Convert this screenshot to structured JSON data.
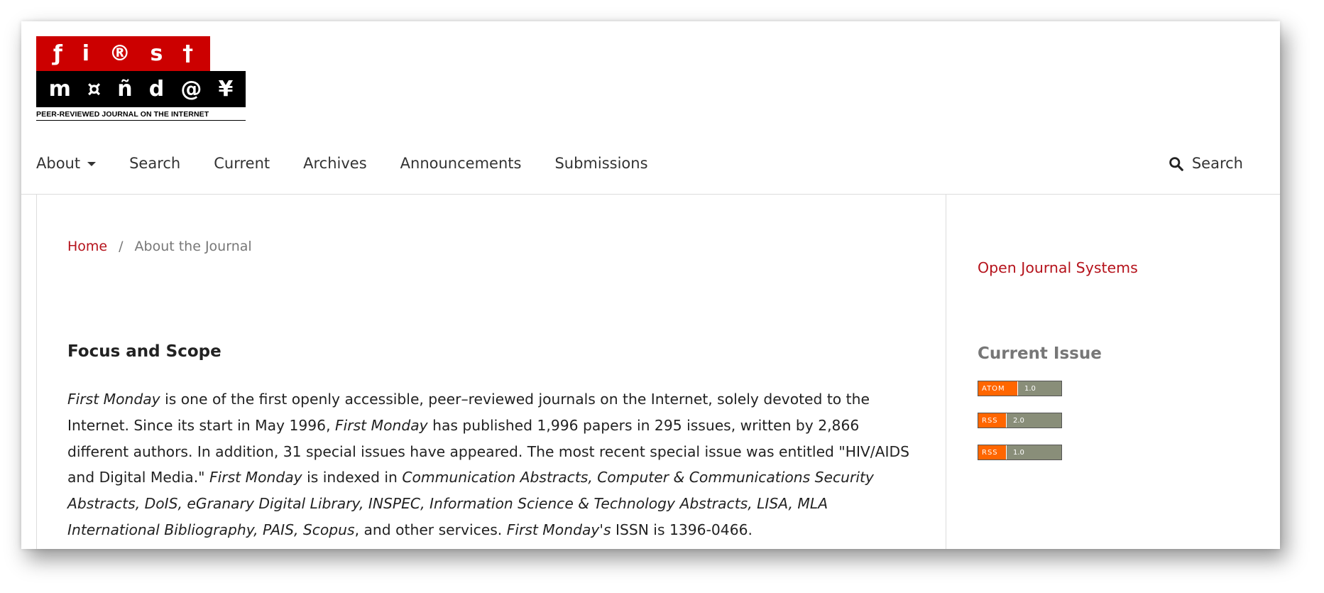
{
  "logo": {
    "row1": [
      "ƒ",
      "i",
      "®",
      "s",
      "†"
    ],
    "row2": [
      "m",
      "¤",
      "ñ",
      "d",
      "@",
      "¥"
    ],
    "tagline": "PEER-REVIEWED JOURNAL ON THE INTERNET",
    "colors": {
      "red": "#cc0000",
      "black": "#000000"
    }
  },
  "nav": {
    "items": [
      {
        "label": "About",
        "has_dropdown": true
      },
      {
        "label": "Search"
      },
      {
        "label": "Current"
      },
      {
        "label": "Archives"
      },
      {
        "label": "Announcements"
      },
      {
        "label": "Submissions"
      }
    ],
    "search_label": "Search",
    "search_icon": "search-icon"
  },
  "breadcrumb": {
    "home": "Home",
    "separator": "/",
    "current": "About the Journal"
  },
  "main": {
    "section_title": "Focus and Scope",
    "scope": {
      "journal_name": "First Monday",
      "s1": " is one of the first openly accessible, peer–reviewed journals on the Internet, solely devoted to the Internet. Since its start in May 1996, ",
      "s2": " has published 1,996 papers in 295 issues, written by 2,866 different authors. In addition, 31 special issues have appeared. The most recent special issue was entitled \"HIV/AIDS and Digital Media.\" ",
      "s3": " is indexed in ",
      "indexes": "Communication Abstracts, Computer & Communications Security Abstracts, DoIS, eGranary Digital Library, INSPEC, Information Science & Technology Abstracts, LISA, MLA International Bibliography, PAIS, Scopus",
      "s4": ", and other services. ",
      "possessive": "First Monday's",
      "s5": " ISSN is 1396-0466."
    }
  },
  "sidebar": {
    "ojs_link": "Open Journal Systems",
    "current_issue_title": "Current Issue",
    "feeds": [
      {
        "format": "ATOM",
        "version": "1.0"
      },
      {
        "format": "RSS",
        "version": "2.0"
      },
      {
        "format": "RSS",
        "version": "1.0"
      }
    ]
  },
  "colors": {
    "link_red": "#b5121b",
    "feed_orange": "#ff6600",
    "feed_gray": "#898e79"
  }
}
